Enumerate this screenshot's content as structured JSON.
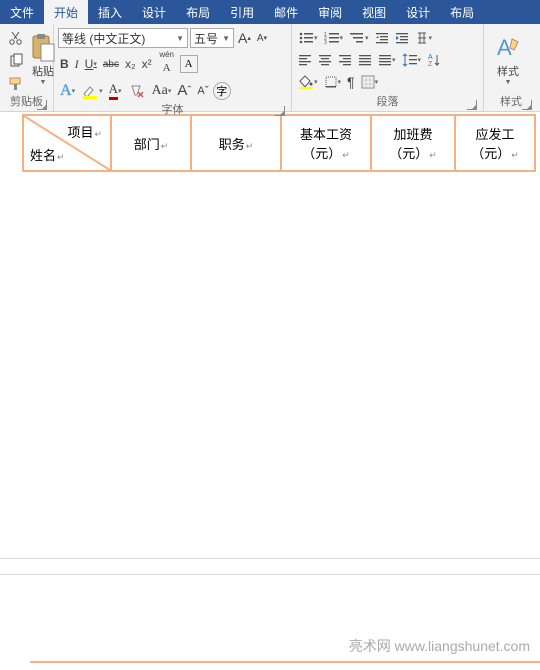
{
  "tabs": [
    "文件",
    "开始",
    "插入",
    "设计",
    "布局",
    "引用",
    "邮件",
    "审阅",
    "视图",
    "设计",
    "布局"
  ],
  "active_tab": 1,
  "clipboard": {
    "paste": "粘贴",
    "label": "剪贴板"
  },
  "font": {
    "name": "等线 (中文正文)",
    "size": "五号",
    "pinyin": "wén",
    "label": "字体",
    "bold": "B",
    "italic": "I",
    "underline": "U",
    "strike": "abc",
    "sub": "x₂",
    "sup": "x²"
  },
  "paragraph": {
    "label": "段落"
  },
  "styles": {
    "label": "样式",
    "button": "样式"
  },
  "table": {
    "headers": [
      {
        "diag": true,
        "top": "项目",
        "bottom": "姓名"
      },
      {
        "text": "部门"
      },
      {
        "text": "职务"
      },
      {
        "text": "基本工资（元）"
      },
      {
        "text": "加班费（元）"
      },
      {
        "text": "应发工（元）"
      }
    ]
  },
  "watermark": "亮术网 www.liangshunet.com"
}
